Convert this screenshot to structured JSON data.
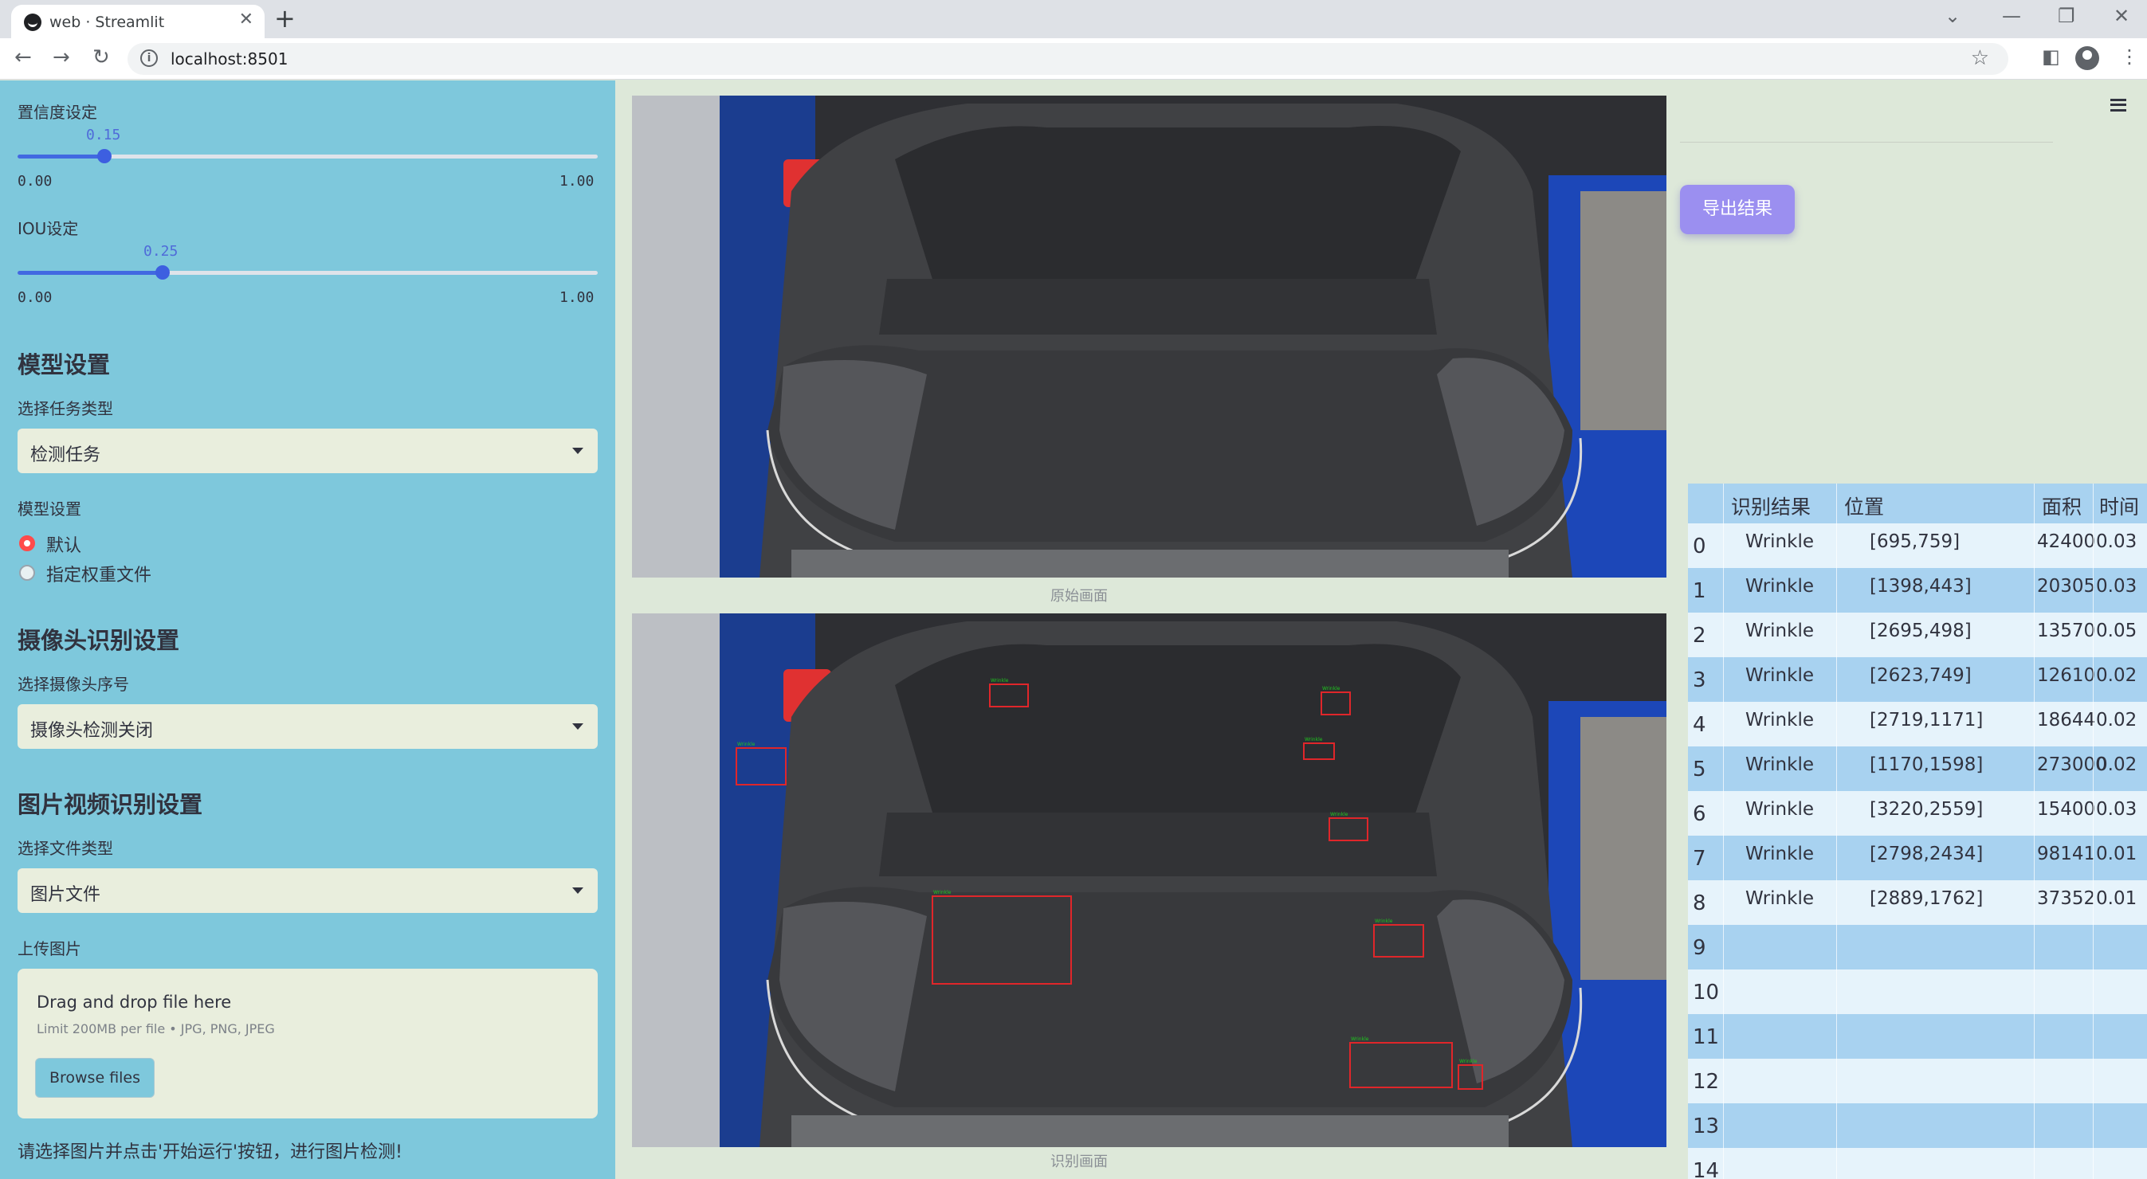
{
  "browser": {
    "tab_title": "web · Streamlit",
    "tab_close": "✕",
    "new_tab": "+",
    "url": "localhost:8501",
    "nav": {
      "back": "←",
      "forward": "→",
      "reload": "↻"
    },
    "window_controls": {
      "dropdown": "⌄",
      "minimize": "—",
      "restore": "❐",
      "close": "✕"
    },
    "star": "☆",
    "more": "⋮",
    "sidepanel": "◧"
  },
  "sidebar": {
    "confidence": {
      "label": "置信度设定",
      "value": "0.15",
      "min": "0.00",
      "max": "1.00",
      "fraction": 0.15
    },
    "iou": {
      "label": "IOU设定",
      "value": "0.25",
      "min": "0.00",
      "max": "1.00",
      "fraction": 0.25
    },
    "model_heading": "模型设置",
    "task_label": "选择任务类型",
    "task_value": "检测任务",
    "model_label": "模型设置",
    "model_options": [
      "默认",
      "指定权重文件"
    ],
    "model_selected": "默认",
    "camera_heading": "摄像头识别设置",
    "camera_label": "选择摄像头序号",
    "camera_value": "摄像头检测关闭",
    "media_heading": "图片视频识别设置",
    "filetype_label": "选择文件类型",
    "filetype_value": "图片文件",
    "upload_label": "上传图片",
    "upload_title": "Drag and drop file here",
    "upload_limit": "Limit 200MB per file • JPG, PNG, JPEG",
    "browse_button": "Browse files",
    "hint": "请选择图片并点击'开始运行'按钮，进行图片检测!"
  },
  "main": {
    "original_caption": "原始画面",
    "result_caption": "识别画面",
    "detection_tag": "Wrinkle"
  },
  "right": {
    "export_button": "导出结果",
    "table": {
      "columns": [
        "识别结果",
        "位置",
        "面积",
        "时间"
      ],
      "rows": [
        {
          "idx": "0",
          "result": "Wrinkle",
          "pos": "[695,759]",
          "area": "42400",
          "time": "0.03"
        },
        {
          "idx": "1",
          "result": "Wrinkle",
          "pos": "[1398,443]",
          "area": "20305",
          "time": "0.03"
        },
        {
          "idx": "2",
          "result": "Wrinkle",
          "pos": "[2695,498]",
          "area": "13570",
          "time": "0.05"
        },
        {
          "idx": "3",
          "result": "Wrinkle",
          "pos": "[2623,749]",
          "area": "12610",
          "time": "0.02"
        },
        {
          "idx": "4",
          "result": "Wrinkle",
          "pos": "[2719,1171]",
          "area": "18644",
          "time": "0.02"
        },
        {
          "idx": "5",
          "result": "Wrinkle",
          "pos": "[1170,1598]",
          "area": "273000",
          "time": "0.02"
        },
        {
          "idx": "6",
          "result": "Wrinkle",
          "pos": "[3220,2559]",
          "area": "15400",
          "time": "0.03"
        },
        {
          "idx": "7",
          "result": "Wrinkle",
          "pos": "[2798,2434]",
          "area": "98141",
          "time": "0.01"
        },
        {
          "idx": "8",
          "result": "Wrinkle",
          "pos": "[2889,1762]",
          "area": "37352",
          "time": "0.01"
        },
        {
          "idx": "9",
          "result": "",
          "pos": "",
          "area": "",
          "time": ""
        },
        {
          "idx": "10",
          "result": "",
          "pos": "",
          "area": "",
          "time": ""
        },
        {
          "idx": "11",
          "result": "",
          "pos": "",
          "area": "",
          "time": ""
        },
        {
          "idx": "12",
          "result": "",
          "pos": "",
          "area": "",
          "time": ""
        },
        {
          "idx": "13",
          "result": "",
          "pos": "",
          "area": "",
          "time": ""
        },
        {
          "idx": "14",
          "result": "",
          "pos": "",
          "area": "",
          "time": ""
        }
      ]
    }
  }
}
